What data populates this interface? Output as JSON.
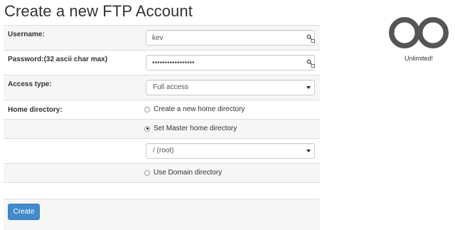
{
  "page": {
    "title": "Create a new FTP Account"
  },
  "form": {
    "username": {
      "label": "Username:",
      "value": "kev",
      "icon": "key-icon"
    },
    "password": {
      "label": "Password:(32 ascii char max)",
      "value": "•••••••••••••••••",
      "icon": "key-icon"
    },
    "access_type": {
      "label": "Access type:",
      "selected": "Full access"
    },
    "home_directory": {
      "label": "Home directory:",
      "options": [
        {
          "label": "Create a new home directory",
          "checked": false
        },
        {
          "label": "Set Master home directory",
          "checked": true
        },
        {
          "label": "Use Domain directory",
          "checked": false
        }
      ],
      "master_dir_selected": "/ (root)"
    },
    "submit_label": "Create"
  },
  "sidebar": {
    "logo_icon": "infinity-icon",
    "caption": "Unlimited!"
  },
  "colors": {
    "primary_button": "#428bca",
    "row_alt": "#f6f6f6",
    "border": "#dddddd"
  }
}
